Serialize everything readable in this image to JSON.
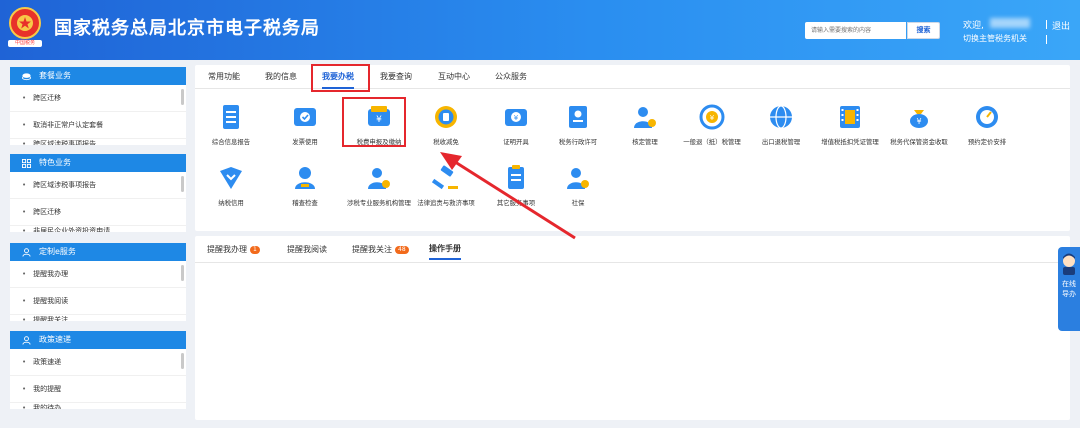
{
  "header": {
    "site_title": "国家税务总局北京市电子税务局",
    "emblem_label": "中国税务",
    "search_placeholder": "请输入需要搜索的内容",
    "search_button": "搜索",
    "welcome": "欢迎,",
    "switch_office": "切换主管税务机关",
    "logout": "退出"
  },
  "sidebar": {
    "sections": [
      {
        "title": "套餐业务",
        "items": [
          "跨区迁移",
          "取消非正常户认定套餐",
          "跨区域涉税事项报告"
        ]
      },
      {
        "title": "特色业务",
        "items": [
          "跨区域涉税事项报告",
          "跨区迁移",
          "非居民企业外资投资申请"
        ]
      },
      {
        "title": "定制e服务",
        "items": [
          "提醒我办理",
          "提醒我阅读",
          "提醒我关注"
        ]
      },
      {
        "title": "政策速递",
        "items": [
          "政策速递",
          "我的提醒",
          "我的待办"
        ]
      }
    ]
  },
  "main": {
    "tabs": [
      "常用功能",
      "我的信息",
      "我要办税",
      "我要查询",
      "互动中心",
      "公众服务"
    ],
    "active_tab": "我要办税",
    "services": [
      {
        "label": "综合信息报告",
        "icon": "document-list-icon"
      },
      {
        "label": "发票使用",
        "icon": "invoice-check-icon"
      },
      {
        "label": "税费申报及缴纳",
        "icon": "yuan-wallet-icon"
      },
      {
        "label": "税收减免",
        "icon": "coin-icon"
      },
      {
        "label": "证明开具",
        "icon": "certificate-icon"
      },
      {
        "label": "税务行政许可",
        "icon": "id-card-icon"
      },
      {
        "label": "核定管理",
        "icon": "user-gear-icon"
      },
      {
        "label": "一般退（抵）税管理",
        "icon": "refund-cycle-icon"
      },
      {
        "label": "出口退税管理",
        "icon": "globe-icon"
      },
      {
        "label": "增值税抵扣凭证管理",
        "icon": "film-voucher-icon"
      },
      {
        "label": "税务代保管资金收取",
        "icon": "money-bag-icon"
      },
      {
        "label": "预约定价安排",
        "icon": "gauge-icon"
      },
      {
        "label": "纳税信用",
        "icon": "shield-heart-icon"
      },
      {
        "label": "稽查检查",
        "icon": "user-icon"
      },
      {
        "label": "涉税专业服务机构管理",
        "icon": "user-badge-icon"
      },
      {
        "label": "法律追责与救济事项",
        "icon": "gavel-icon"
      },
      {
        "label": "其它服务事项",
        "icon": "clipboard-icon"
      },
      {
        "label": "社保",
        "icon": "user-plus-icon"
      }
    ]
  },
  "bottom": {
    "tabs": [
      {
        "label": "提醒我办理",
        "badge": "1"
      },
      {
        "label": "提醒我阅读",
        "badge": ""
      },
      {
        "label": "提醒我关注",
        "badge": "48"
      },
      {
        "label": "操作手册",
        "badge": ""
      }
    ],
    "active_tab": "操作手册"
  },
  "assistant": {
    "label": "在线导办"
  },
  "colors": {
    "header_blue": "#1f63d6",
    "accent_blue": "#1e88e5",
    "highlight_red": "#e5272d",
    "badge_orange": "#f26a1b"
  }
}
